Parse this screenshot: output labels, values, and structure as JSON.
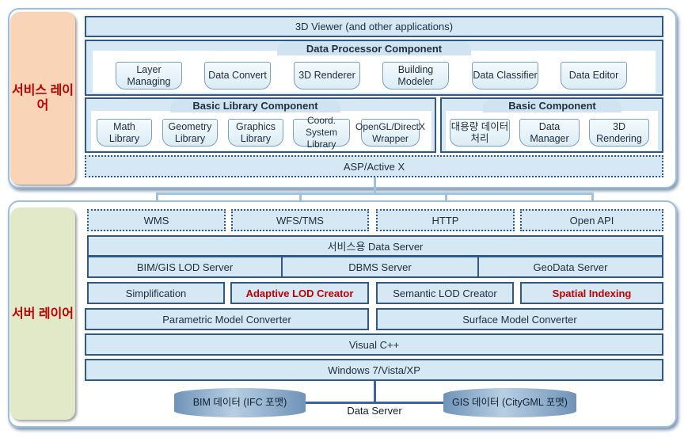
{
  "service_layer": {
    "label": "서비스 레이어",
    "viewer": "3D Viewer (and other applications)",
    "data_processor": {
      "title": "Data Processor  Component",
      "items": [
        "Layer Managing",
        "Data Convert",
        "3D Renderer",
        "Building Modeler",
        "Data Classifier",
        "Data Editor"
      ]
    },
    "basic_library": {
      "title": "Basic Library Component",
      "items": [
        "Math Library",
        "Geometry Library",
        "Graphics Library",
        "Coord. System Library",
        "OpenGL/DirectX Wrapper"
      ]
    },
    "basic_component": {
      "title": "Basic Component",
      "items": [
        "대용량 데이터 처리",
        "Data Manager",
        "3D Rendering"
      ]
    },
    "asp": "ASP/Active X"
  },
  "server_layer": {
    "label": "서버 레이어",
    "protocols": [
      "WMS",
      "WFS/TMS",
      "HTTP",
      "Open API"
    ],
    "data_server": "서비스용 Data Server",
    "servers": [
      "BIM/GIS LOD Server",
      "DBMS  Server",
      "GeoData Server"
    ],
    "lod": [
      "Simplification",
      "Adaptive LOD Creator",
      "Semantic LOD Creator",
      "Spatial Indexing"
    ],
    "converters": [
      "Parametric Model Converter",
      "Surface Model Converter"
    ],
    "visual_cpp": "Visual C++",
    "windows": "Windows 7/Vista/XP",
    "databases": [
      "BIM 데이터 (IFC 포맷)",
      "GIS 데이터 (CityGML 포맷)"
    ],
    "db_label": "Data Server"
  },
  "colors": {
    "highlight": "#c00000",
    "bar": "#d5e8f3",
    "border": "#2f5a88"
  }
}
